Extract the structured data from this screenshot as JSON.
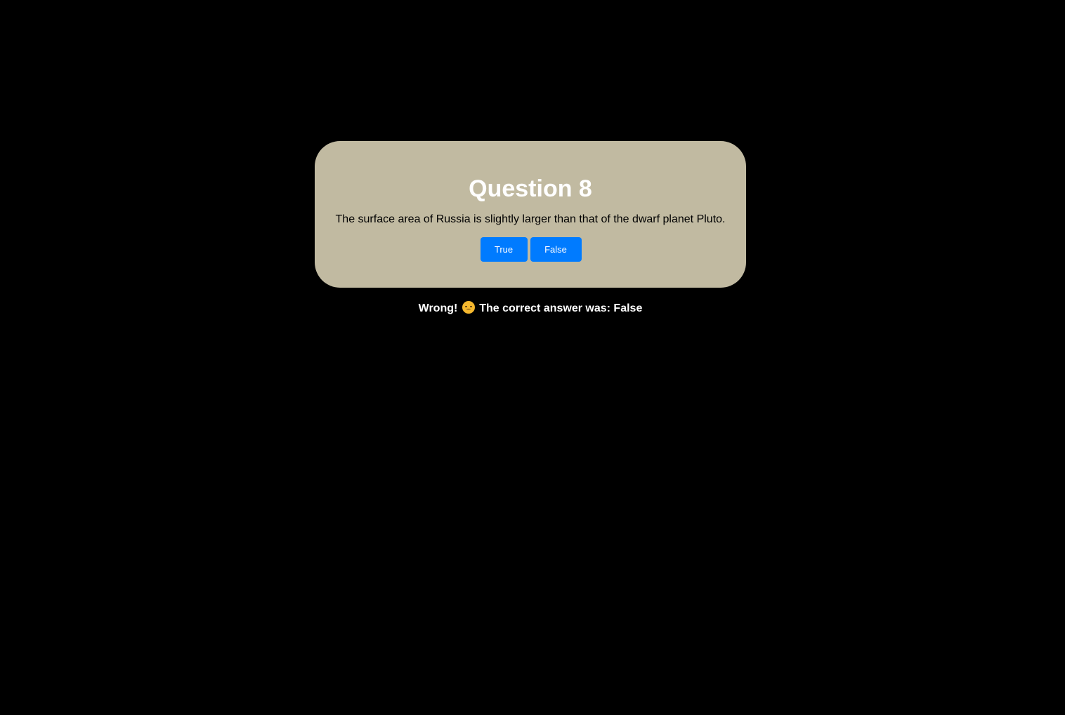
{
  "quiz": {
    "question_title": "Question 8",
    "question_text": "The surface area of Russia is slightly larger than that of the dwarf planet Pluto.",
    "answers": [
      {
        "label": "True"
      },
      {
        "label": "False"
      }
    ]
  },
  "feedback": {
    "prefix": "Wrong!",
    "icon": "sad-face-icon",
    "message": "The correct answer was: False"
  },
  "colors": {
    "background": "#000000",
    "card": "#c1baa1",
    "button": "#007bff",
    "title": "#ffffff"
  }
}
